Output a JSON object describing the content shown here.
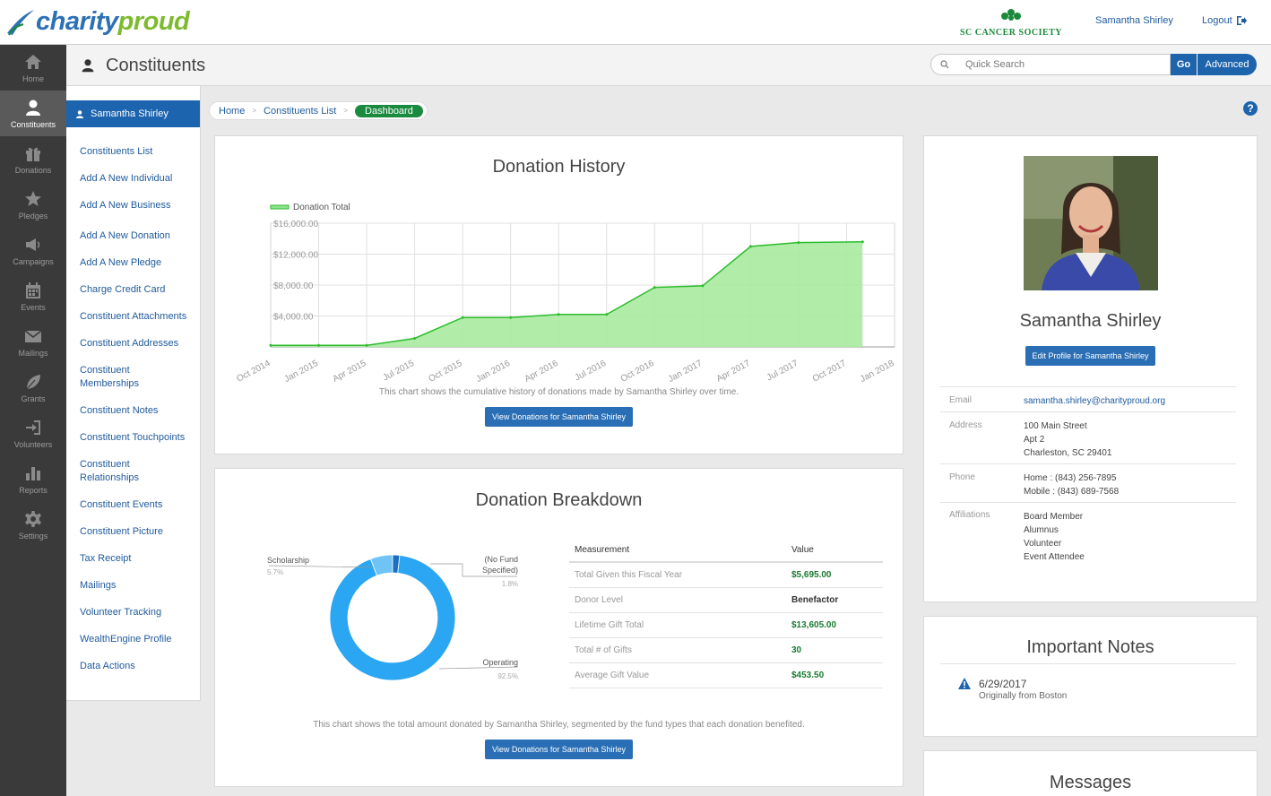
{
  "brand": {
    "logo_part1": "charity",
    "logo_part2": "proud",
    "org_name": "SC CANCER SOCIETY"
  },
  "header": {
    "user_name": "Samantha Shirley",
    "logout_label": "Logout"
  },
  "nav": [
    {
      "label": "Home",
      "icon": "home-icon"
    },
    {
      "label": "Constituents",
      "icon": "person-icon",
      "active": true
    },
    {
      "label": "Donations",
      "icon": "gift-icon"
    },
    {
      "label": "Pledges",
      "icon": "star-icon"
    },
    {
      "label": "Campaigns",
      "icon": "megaphone-icon"
    },
    {
      "label": "Events",
      "icon": "calendar-icon"
    },
    {
      "label": "Mailings",
      "icon": "envelope-icon"
    },
    {
      "label": "Grants",
      "icon": "leaf-icon"
    },
    {
      "label": "Volunteers",
      "icon": "sign-in-icon"
    },
    {
      "label": "Reports",
      "icon": "bar-chart-icon"
    },
    {
      "label": "Settings",
      "icon": "gear-icon"
    }
  ],
  "page": {
    "title": "Constituents"
  },
  "search": {
    "placeholder": "Quick Search",
    "go_label": "Go",
    "advanced_label": "Advanced"
  },
  "subnav": {
    "header": "Samantha Shirley",
    "links": [
      "Constituents List",
      "Add A New Individual",
      "Add A New Business",
      "Add A New Donation",
      "Add A New Pledge",
      "Charge Credit Card",
      "Constituent Attachments",
      "Constituent Addresses",
      "Constituent Memberships",
      "Constituent Notes",
      "Constituent Touchpoints",
      "Constituent Relationships",
      "Constituent Events",
      "Constituent Picture",
      "Tax Receipt",
      "Mailings",
      "Volunteer Tracking",
      "WealthEngine Profile",
      "Data Actions"
    ]
  },
  "breadcrumb": {
    "home": "Home",
    "list": "Constituents List",
    "current": "Dashboard"
  },
  "donation_history": {
    "title": "Donation History",
    "legend": "Donation Total",
    "note": "This chart shows the cumulative history of donations made by Samantha Shirley over time.",
    "button": "View Donations for Samantha Shirley"
  },
  "donation_breakdown": {
    "title": "Donation Breakdown",
    "note": "This chart shows the total amount donated by Samantha Shirley, segmented by the fund types that each donation benefited.",
    "button": "View Donations for Samantha Shirley",
    "table_headers": {
      "measure": "Measurement",
      "value": "Value"
    },
    "rows": [
      {
        "label": "Total Given this Fiscal Year",
        "value": "$5,695.00"
      },
      {
        "label": "Donor Level",
        "value": "Benefactor"
      },
      {
        "label": "Lifetime Gift Total",
        "value": "$13,605.00"
      },
      {
        "label": "Total # of Gifts",
        "value": "30"
      },
      {
        "label": "Average Gift Value",
        "value": "$453.50"
      }
    ]
  },
  "chart_data": [
    {
      "type": "area",
      "title": "Donation History",
      "legend": [
        "Donation Total"
      ],
      "x_ticks": [
        "Oct 2014",
        "Jan 2015",
        "Apr 2015",
        "Jul 2015",
        "Oct 2015",
        "Jan 2016",
        "Apr 2016",
        "Jul 2016",
        "Oct 2016",
        "Jan 2017",
        "Apr 2017",
        "Jul 2017",
        "Oct 2017",
        "Jan 2018"
      ],
      "y_ticks": [
        "$4,000.00",
        "$8,000.00",
        "$12,000.00",
        "$16,000.00"
      ],
      "ylim": [
        0,
        16000
      ],
      "series": [
        {
          "name": "Donation Total",
          "x": [
            "2014-10",
            "2015-01",
            "2015-04",
            "2015-07",
            "2015-10",
            "2016-01",
            "2016-04",
            "2016-07",
            "2016-10",
            "2017-01",
            "2017-04",
            "2017-07",
            "2017-11"
          ],
          "values": [
            200,
            200,
            200,
            1100,
            3800,
            3800,
            4200,
            4200,
            7700,
            7900,
            13000,
            13500,
            13600
          ]
        }
      ],
      "color": "#2dbd2d"
    },
    {
      "type": "pie",
      "title": "Donation Breakdown",
      "labels": [
        "Operating",
        "Scholarship",
        "(No Fund Specified)"
      ],
      "values": [
        92.5,
        5.7,
        1.8
      ],
      "display": [
        "92.5%",
        "5.7%",
        "1.8%"
      ],
      "colors": [
        "#2aa6f2",
        "#6fc3f5",
        "#1a6fc0"
      ]
    }
  ],
  "profile": {
    "name": "Samantha Shirley",
    "edit_button": "Edit Profile for Samantha Shirley",
    "email_label": "Email",
    "email": "samantha.shirley@charityproud.org",
    "address_label": "Address",
    "address": [
      "100 Main Street",
      "Apt 2",
      "Charleston, SC 29401"
    ],
    "phone_label": "Phone",
    "phone": [
      "Home : (843) 256-7895",
      "Mobile : (843) 689-7568"
    ],
    "affiliations_label": "Affiliations",
    "affiliations": [
      "Board Member",
      "Alumnus",
      "Volunteer",
      "Event Attendee"
    ]
  },
  "notes": {
    "title": "Important Notes",
    "date": "6/29/2017",
    "text": "Originally from Boston"
  },
  "messages": {
    "title": "Messages"
  }
}
